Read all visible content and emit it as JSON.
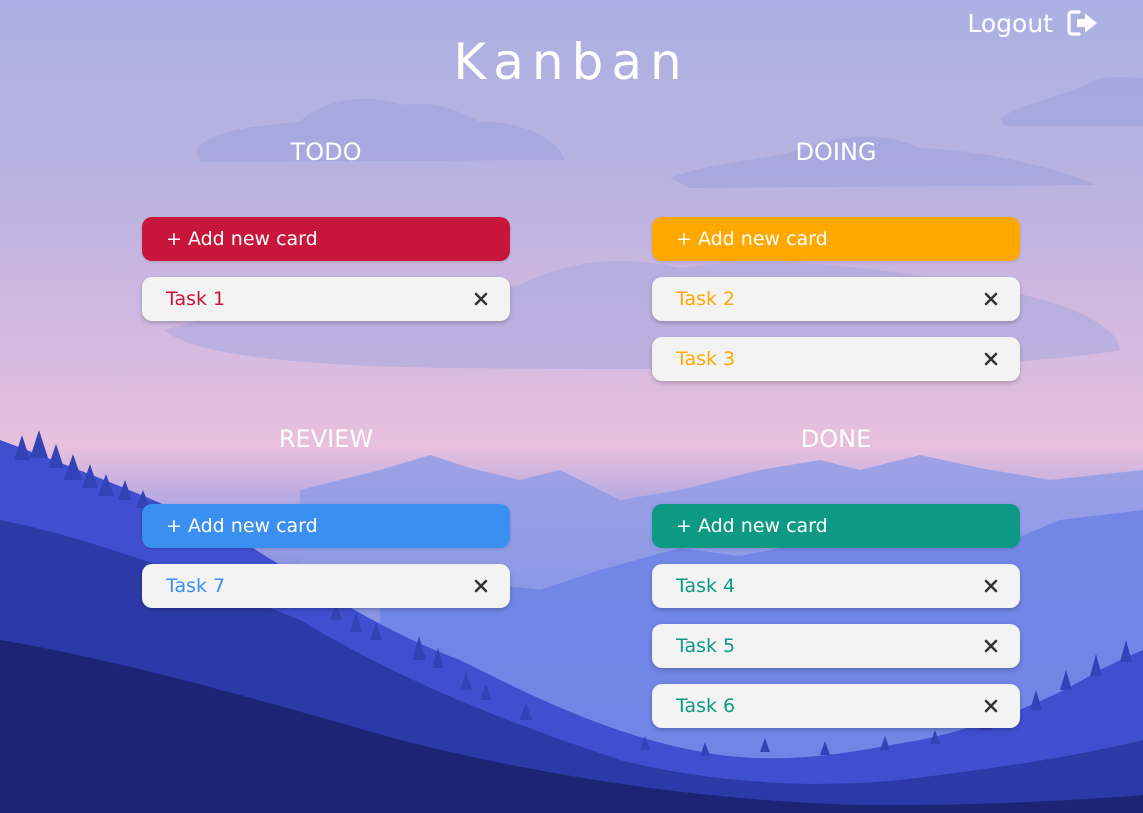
{
  "app": {
    "title": "Kanban",
    "logout_label": "Logout",
    "logout_icon": "sign-out-icon"
  },
  "columns": [
    {
      "key": "todo",
      "title": "TODO",
      "color": "#c8163a",
      "add_label": "+ Add new card",
      "cards": [
        {
          "title": "Task 1"
        }
      ]
    },
    {
      "key": "doing",
      "title": "DOING",
      "color": "#ffa800",
      "add_label": "+ Add new card",
      "cards": [
        {
          "title": "Task 2"
        },
        {
          "title": "Task 3"
        }
      ]
    },
    {
      "key": "review",
      "title": "REVIEW",
      "color": "#3a8ff0",
      "add_label": "+ Add new card",
      "cards": [
        {
          "title": "Task 7"
        }
      ]
    },
    {
      "key": "done",
      "title": "DONE",
      "color": "#0d9a85",
      "add_label": "+ Add new card",
      "cards": [
        {
          "title": "Task 4"
        },
        {
          "title": "Task 5"
        },
        {
          "title": "Task 6"
        }
      ]
    }
  ],
  "colors": {
    "close_icon": "#333333",
    "card_background": "#f3f3f3"
  }
}
